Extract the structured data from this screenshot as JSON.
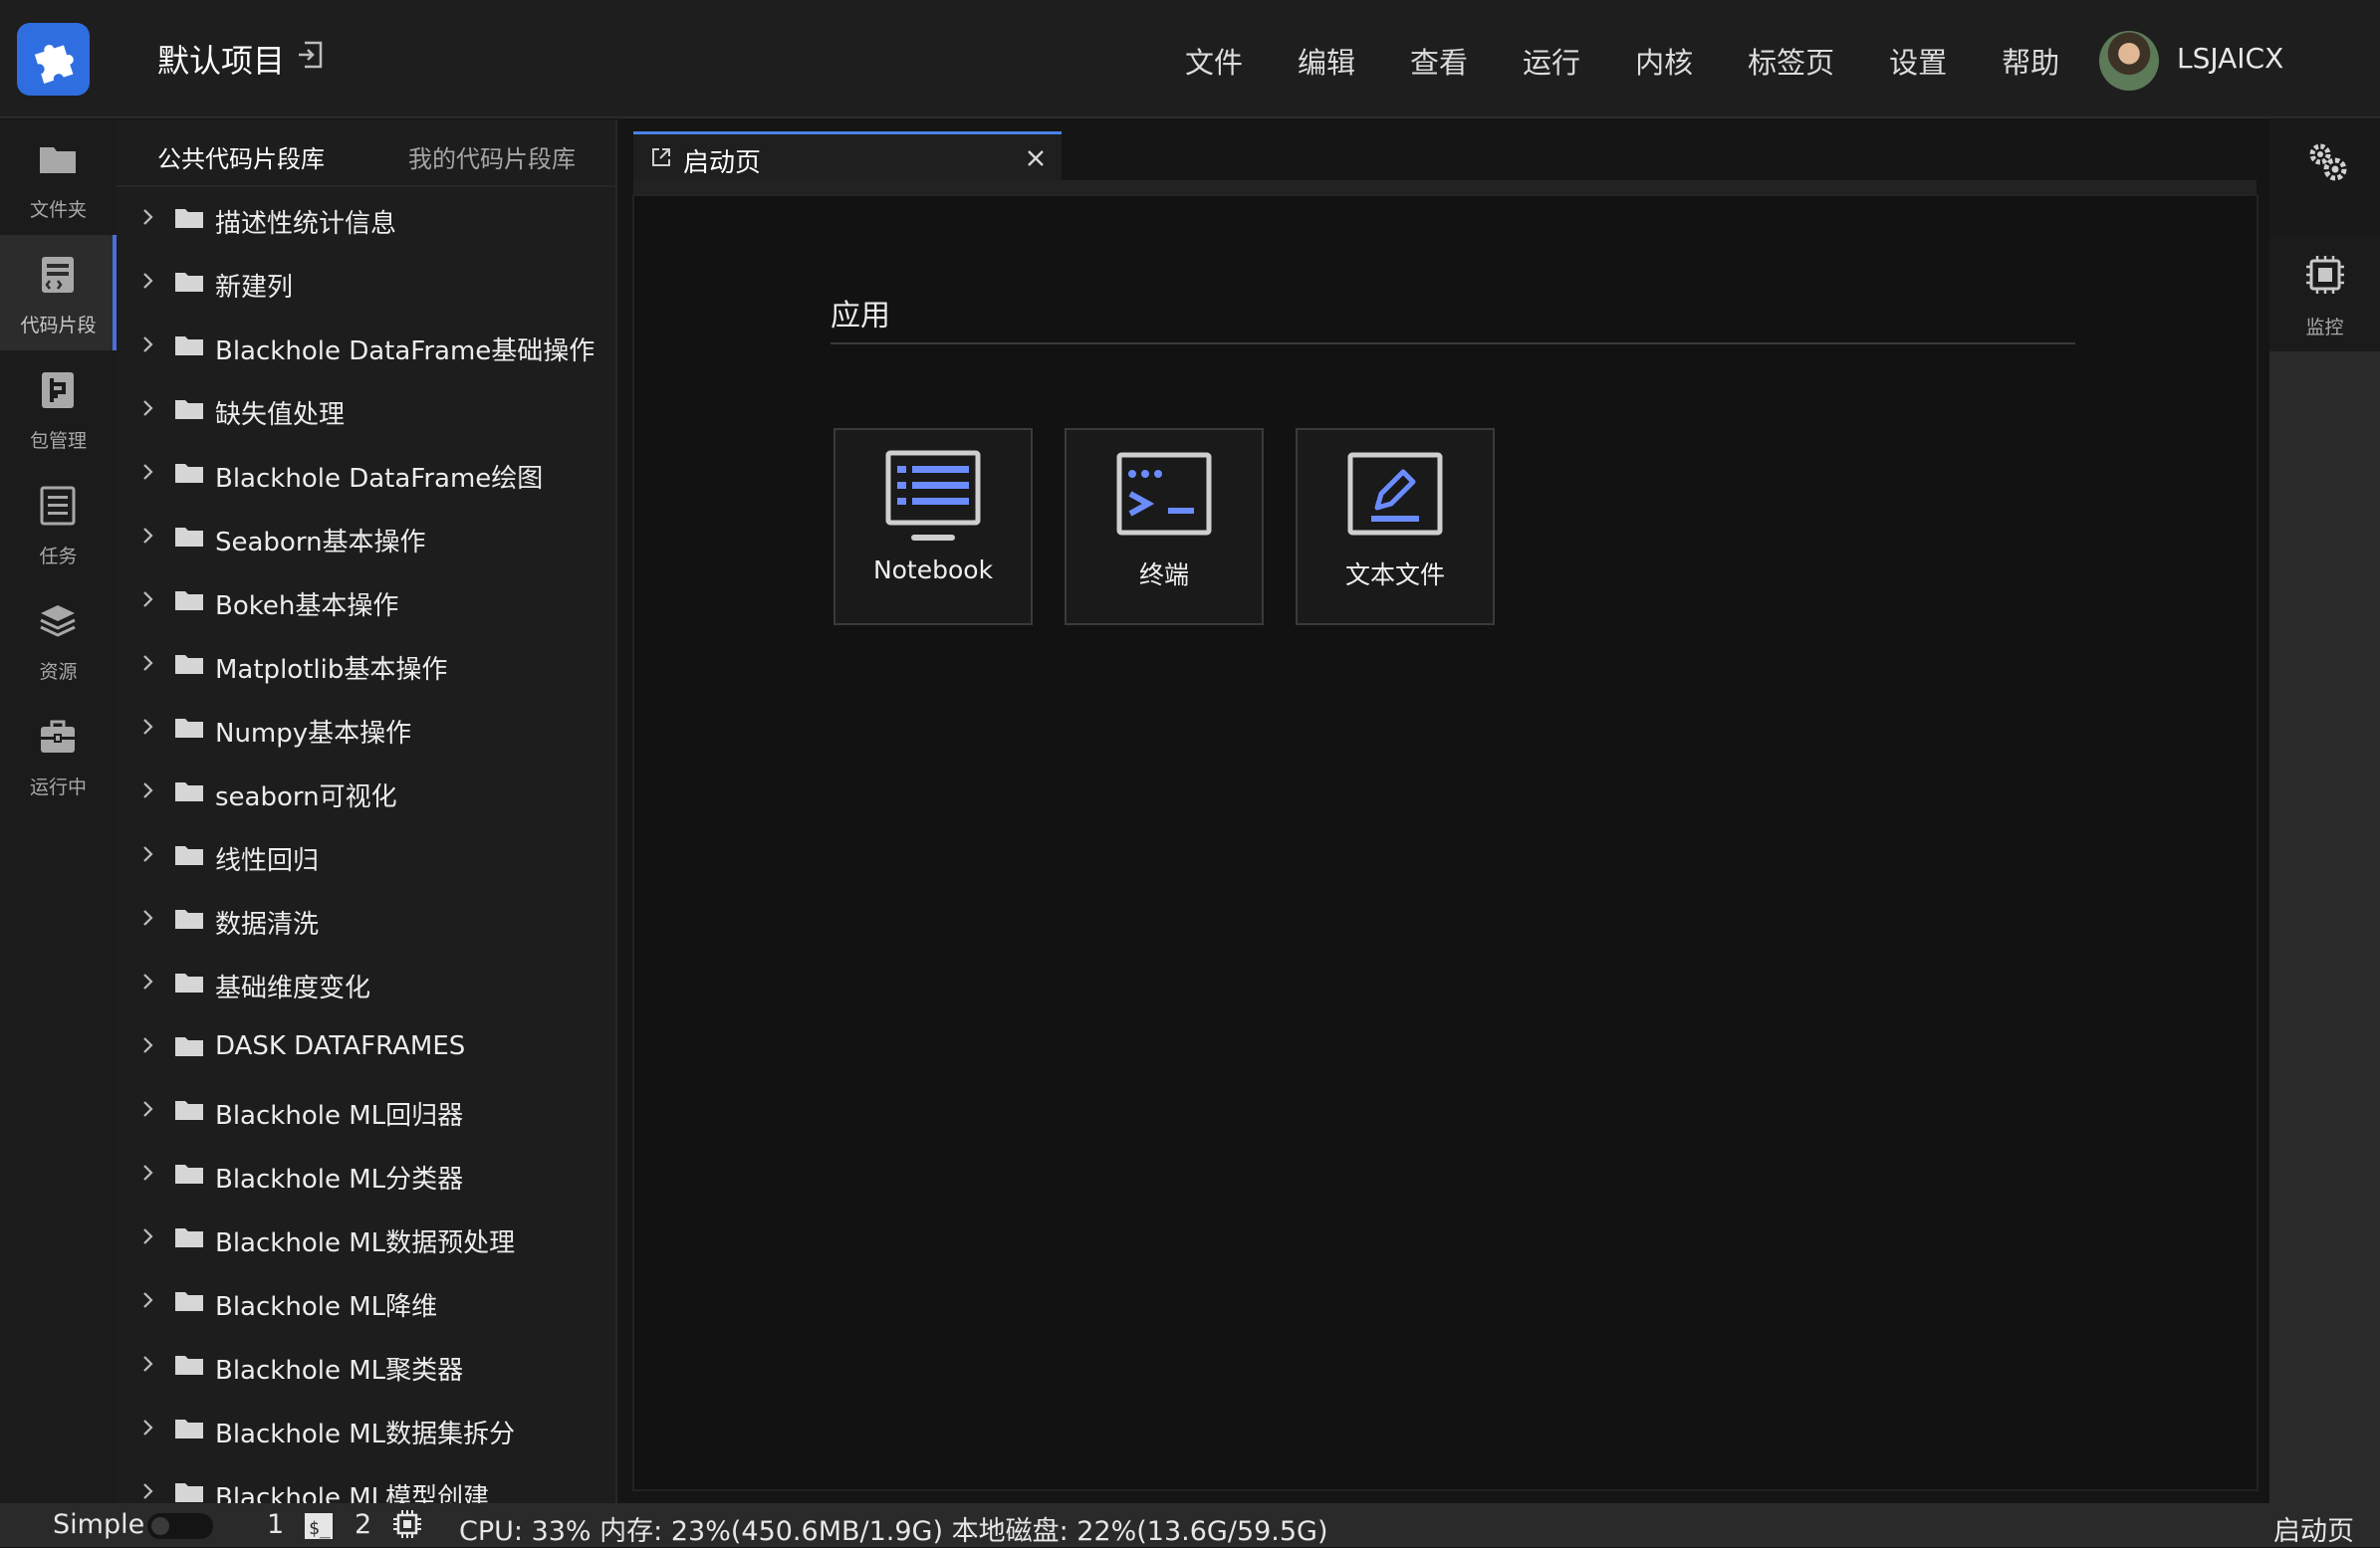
{
  "header": {
    "project_title": "默认项目",
    "menu": [
      "文件",
      "编辑",
      "查看",
      "运行",
      "内核",
      "标签页",
      "设置",
      "帮助"
    ],
    "username": "LSJAICX"
  },
  "activity_bar": [
    {
      "label": "文件夹",
      "icon": "folder-icon"
    },
    {
      "label": "代码片段",
      "icon": "code-snippet-icon",
      "active": true
    },
    {
      "label": "包管理",
      "icon": "package-icon"
    },
    {
      "label": "任务",
      "icon": "task-icon"
    },
    {
      "label": "资源",
      "icon": "layers-icon"
    },
    {
      "label": "运行中",
      "icon": "briefcase-icon"
    }
  ],
  "snippet_panel": {
    "tabs": [
      "公共代码片段库",
      "我的代码片段库"
    ],
    "items": [
      "描述性统计信息",
      "新建列",
      "Blackhole DataFrame基础操作",
      "缺失值处理",
      "Blackhole DataFrame绘图",
      "Seaborn基本操作",
      "Bokeh基本操作",
      "Matplotlib基本操作",
      "Numpy基本操作",
      "seaborn可视化",
      "线性回归",
      "数据清洗",
      "基础维度变化",
      "DASK DATAFRAMES",
      "Blackhole ML回归器",
      "Blackhole ML分类器",
      "Blackhole ML数据预处理",
      "Blackhole ML降维",
      "Blackhole ML聚类器",
      "Blackhole ML数据集拆分",
      "Blackhole ML模型创建"
    ]
  },
  "editor": {
    "tab_label": "启动页",
    "section_title": "应用",
    "apps": [
      {
        "label": "Notebook",
        "icon": "notebook-icon"
      },
      {
        "label": "终端",
        "icon": "terminal-icon"
      },
      {
        "label": "文本文件",
        "icon": "text-file-icon"
      }
    ]
  },
  "right_bar": {
    "monitor_label": "监控"
  },
  "status_bar": {
    "mode_label": "Simple",
    "kernel_count": "1",
    "terminal_count": "2",
    "resources": "CPU:  33% 内存:  23%(450.6MB/1.9G) 本地磁盘:  22%(13.6G/59.5G)",
    "current_page": "启动页"
  },
  "colors": {
    "accent": "#4a6fe0",
    "logo_bg": "#2f6ee0",
    "icon_blue": "#6b8cff",
    "background": "#111111"
  }
}
